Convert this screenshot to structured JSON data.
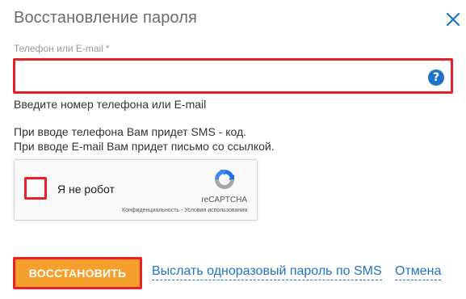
{
  "dialog": {
    "title": "Восстановление пароля",
    "close_icon": "close-icon"
  },
  "field": {
    "label": "Телефон или E-mail",
    "required_mark": "*",
    "value": "",
    "help_icon": "question-circle-icon",
    "help_glyph": "?"
  },
  "hint": "Введите номер телефона или E-mail",
  "info": {
    "line1": "При вводе телефона Вам придет SMS - код.",
    "line2": "При вводе E-mail Вам придет письмо со ссылкой."
  },
  "recaptcha": {
    "label": "Я не робот",
    "brand": "reCAPTCHA",
    "privacy": "Конфиденциальность",
    "separator": " - ",
    "terms": "Условия использования",
    "logo_icon": "recaptcha-logo-icon"
  },
  "actions": {
    "restore_label": "ВОССТАНОВИТЬ",
    "sms_label": "Выслать одноразовый пароль по SMS",
    "cancel_label": "Отмена"
  },
  "colors": {
    "accent_blue": "#1e74c8",
    "button_orange": "#f5a02c",
    "highlight_red": "#e8202a"
  }
}
